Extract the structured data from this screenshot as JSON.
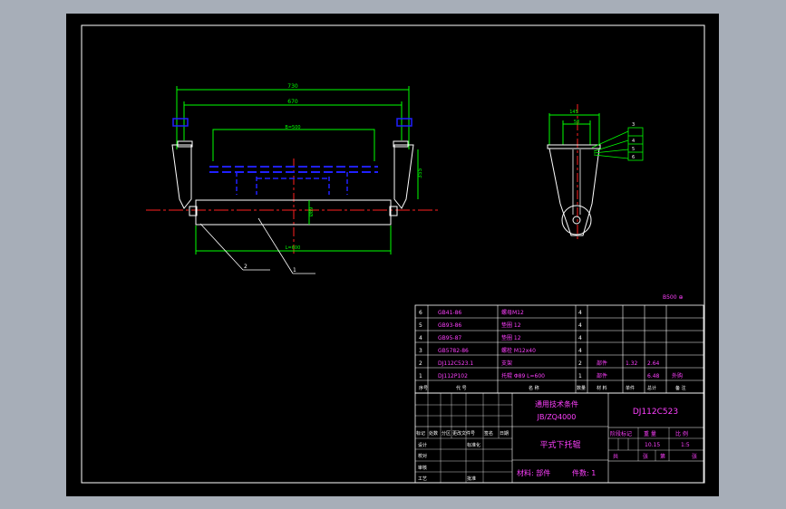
{
  "drawing": {
    "overall_length_dim": "730",
    "inner_span_dim": "670",
    "belt_width_label": "B=500",
    "height_dim": "355",
    "roller_dia_dim": "Ø89",
    "roller_length_dim": "L=600",
    "leader_labels": [
      "2",
      "1"
    ],
    "side_width_dim": "145",
    "side_inner_dim": "58",
    "side_leader_labels": [
      "3",
      "4",
      "5",
      "6"
    ],
    "corner_note": "B500   ⊕"
  },
  "parts_list": {
    "rows": [
      {
        "no": "6",
        "code": "GB41-86",
        "name": "螺母M12",
        "qty": "4",
        "mat": "",
        "w1": "",
        "w2": "",
        "note": ""
      },
      {
        "no": "5",
        "code": "GB93-86",
        "name": "垫圈 12",
        "qty": "4",
        "mat": "",
        "w1": "",
        "w2": "",
        "note": ""
      },
      {
        "no": "4",
        "code": "GB95-87",
        "name": "垫圈 12",
        "qty": "4",
        "mat": "",
        "w1": "",
        "w2": "",
        "note": ""
      },
      {
        "no": "3",
        "code": "GB5782-86",
        "name": "螺栓 M12x40",
        "qty": "4",
        "mat": "",
        "w1": "",
        "w2": "",
        "note": ""
      },
      {
        "no": "2",
        "code": "DJ112C523.1",
        "name": "支架",
        "qty": "2",
        "mat": "部件",
        "w1": "1.32",
        "w2": "2.64",
        "note": ""
      },
      {
        "no": "1",
        "code": "DJ112P102",
        "name": "托辊 Φ89 L=600",
        "qty": "1",
        "mat": "部件",
        "w1": "",
        "w2": "6.48",
        "note": "外购"
      }
    ],
    "header": [
      "序号",
      "代 号",
      "名 称",
      "数量",
      "材 料",
      "单件",
      "总计",
      "备 注"
    ],
    "weight_header": "重量"
  },
  "title_block": {
    "standard_line1": "通用技术条件",
    "standard_line2": "JB/ZQ4000",
    "drawing_no": "DJ112C523",
    "part_name": "平式下托辊",
    "material_line": "材料: 部件",
    "count_line": "件数: 1",
    "stage_header": "阶段标记",
    "weight_header": "重 量",
    "scale_header": "比 例",
    "weight_value": "10.15",
    "scale_value": "1:5",
    "sheet_total": "共",
    "sheet_label": "张",
    "sheet_no": "第",
    "sheet_label2": "张",
    "rev_headers": [
      "标记",
      "处数",
      "分区",
      "更改文件号",
      "签名",
      "日期"
    ],
    "sign_rows": [
      "设计",
      "审核",
      "工艺"
    ],
    "sign_right": [
      "标准化",
      "",
      "批准"
    ],
    "sign_mid": "校对"
  }
}
